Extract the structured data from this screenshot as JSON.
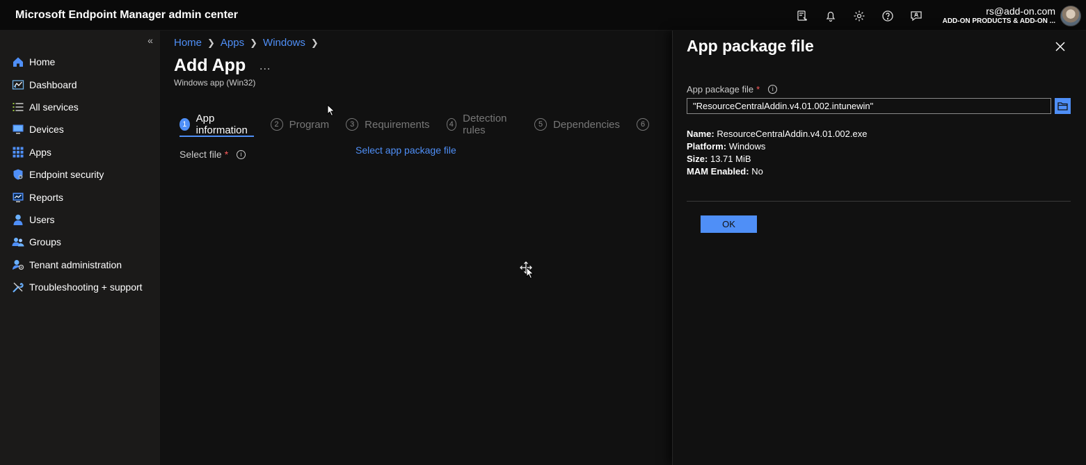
{
  "app": {
    "title": "Microsoft Endpoint Manager admin center"
  },
  "header": {
    "icons": [
      "feedback-device-icon",
      "bell-icon",
      "gear-icon",
      "help-icon",
      "feedback-icon"
    ],
    "account_email": "rs@add-on.com",
    "account_org": "ADD-ON PRODUCTS & ADD-ON ..."
  },
  "sidebar": {
    "collapse": "«",
    "items": [
      {
        "label": "Home",
        "icon": "home-icon"
      },
      {
        "label": "Dashboard",
        "icon": "dashboard-icon"
      },
      {
        "label": "All services",
        "icon": "list-icon"
      },
      {
        "label": "Devices",
        "icon": "devices-icon"
      },
      {
        "label": "Apps",
        "icon": "apps-icon"
      },
      {
        "label": "Endpoint security",
        "icon": "shield-icon"
      },
      {
        "label": "Reports",
        "icon": "reports-icon"
      },
      {
        "label": "Users",
        "icon": "user-icon"
      },
      {
        "label": "Groups",
        "icon": "groups-icon"
      },
      {
        "label": "Tenant administration",
        "icon": "tenant-admin-icon"
      },
      {
        "label": "Troubleshooting + support",
        "icon": "wrench-icon"
      }
    ]
  },
  "main": {
    "breadcrumb": [
      "Home",
      "Apps",
      "Windows"
    ],
    "title": "Add App",
    "more": "...",
    "subtitle": "Windows app (Win32)",
    "steps": [
      {
        "num": "1",
        "label": "App information",
        "active": true
      },
      {
        "num": "2",
        "label": "Program"
      },
      {
        "num": "3",
        "label": "Requirements"
      },
      {
        "num": "4",
        "label": "Detection rules"
      },
      {
        "num": "5",
        "label": "Dependencies"
      },
      {
        "num": "6",
        "label": ""
      }
    ],
    "select_file_label": "Select file",
    "required_mark": "*",
    "select_link": "Select app package file"
  },
  "panel": {
    "title": "App package file",
    "field_label": "App package file",
    "required_mark": "*",
    "file_value": "\"ResourceCentralAddin.v4.01.002.intunewin\"",
    "meta": {
      "name_key": "Name:",
      "name_val": "ResourceCentralAddin.v4.01.002.exe",
      "platform_key": "Platform:",
      "platform_val": "Windows",
      "size_key": "Size:",
      "size_val": "13.71 MiB",
      "mam_key": "MAM Enabled:",
      "mam_val": "No"
    },
    "ok_label": "OK"
  },
  "colors": {
    "accent": "#4f8ff7",
    "required": "#ff5c5c",
    "background": "#111111",
    "sidebar": "#1b1a19"
  }
}
